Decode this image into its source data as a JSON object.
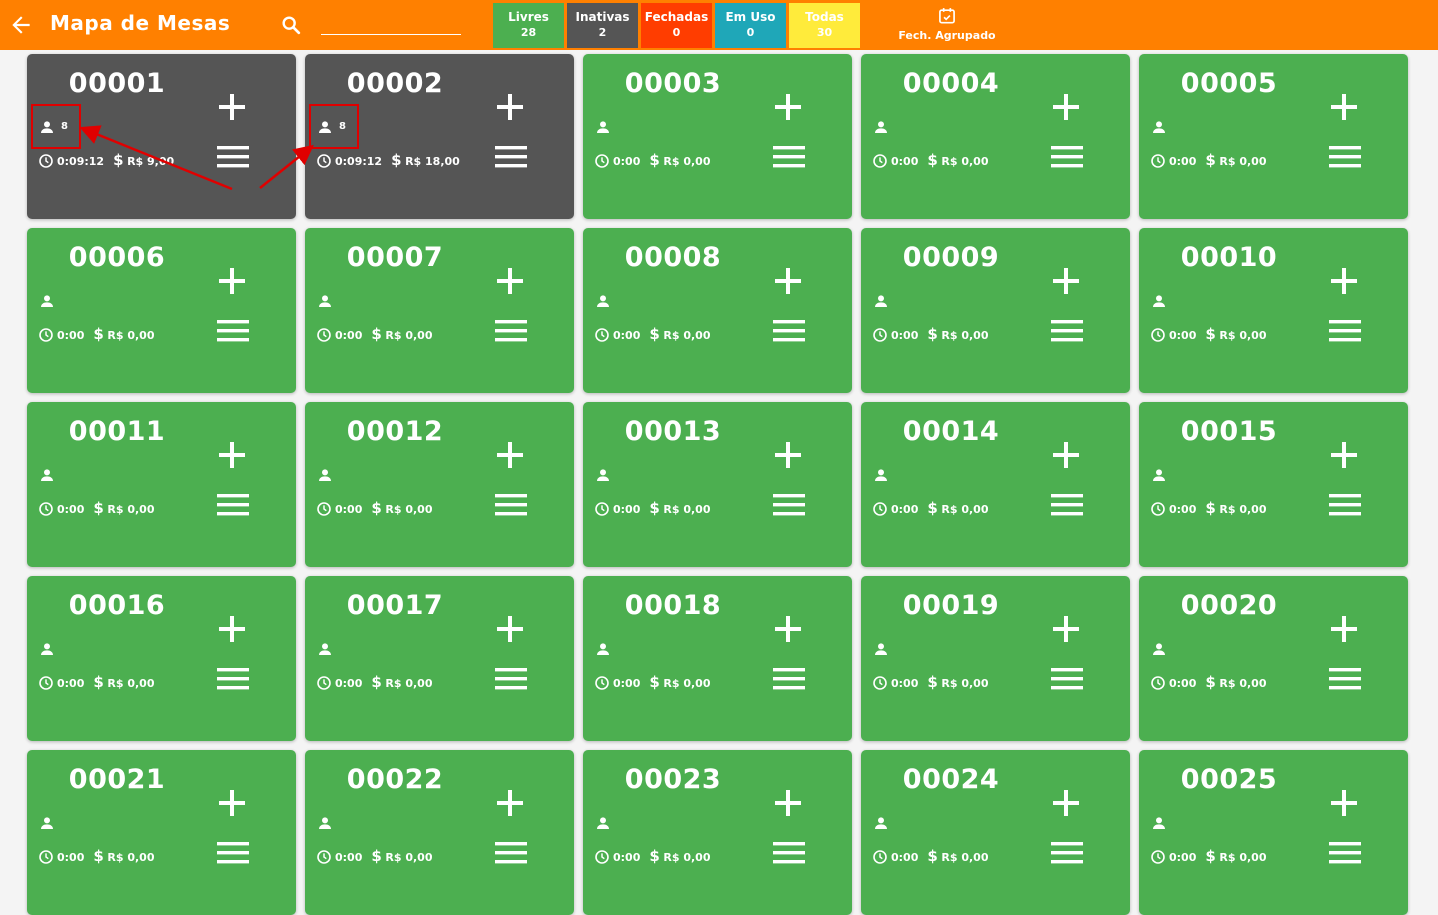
{
  "header": {
    "title": "Mapa de Mesas",
    "search_placeholder": "",
    "filters": [
      {
        "label": "Livres",
        "count": "28",
        "color": "#4caf50"
      },
      {
        "label": "Inativas",
        "count": "2",
        "color": "#555555"
      },
      {
        "label": "Fechadas",
        "count": "0",
        "color": "#ff3d00"
      },
      {
        "label": "Em Uso",
        "count": "0",
        "color": "#1fa7b8"
      },
      {
        "label": "Todas",
        "count": "30",
        "color": "#ffeb3b"
      }
    ],
    "group_close_label": "Fech. Agrupado"
  },
  "colors": {
    "header": "#ff8000",
    "free": "#4caf50",
    "inactive": "#555555",
    "highlight": "#e00000"
  },
  "tables": [
    {
      "number": "00001",
      "status": "inactive",
      "people": "8",
      "time": "0:09:12",
      "amount": "R$ 9,00"
    },
    {
      "number": "00002",
      "status": "inactive",
      "people": "8",
      "time": "0:09:12",
      "amount": "R$ 18,00"
    },
    {
      "number": "00003",
      "status": "free",
      "people": "",
      "time": "0:00",
      "amount": "R$ 0,00"
    },
    {
      "number": "00004",
      "status": "free",
      "people": "",
      "time": "0:00",
      "amount": "R$ 0,00"
    },
    {
      "number": "00005",
      "status": "free",
      "people": "",
      "time": "0:00",
      "amount": "R$ 0,00"
    },
    {
      "number": "00006",
      "status": "free",
      "people": "",
      "time": "0:00",
      "amount": "R$ 0,00"
    },
    {
      "number": "00007",
      "status": "free",
      "people": "",
      "time": "0:00",
      "amount": "R$ 0,00"
    },
    {
      "number": "00008",
      "status": "free",
      "people": "",
      "time": "0:00",
      "amount": "R$ 0,00"
    },
    {
      "number": "00009",
      "status": "free",
      "people": "",
      "time": "0:00",
      "amount": "R$ 0,00"
    },
    {
      "number": "00010",
      "status": "free",
      "people": "",
      "time": "0:00",
      "amount": "R$ 0,00"
    },
    {
      "number": "00011",
      "status": "free",
      "people": "",
      "time": "0:00",
      "amount": "R$ 0,00"
    },
    {
      "number": "00012",
      "status": "free",
      "people": "",
      "time": "0:00",
      "amount": "R$ 0,00"
    },
    {
      "number": "00013",
      "status": "free",
      "people": "",
      "time": "0:00",
      "amount": "R$ 0,00"
    },
    {
      "number": "00014",
      "status": "free",
      "people": "",
      "time": "0:00",
      "amount": "R$ 0,00"
    },
    {
      "number": "00015",
      "status": "free",
      "people": "",
      "time": "0:00",
      "amount": "R$ 0,00"
    },
    {
      "number": "00016",
      "status": "free",
      "people": "",
      "time": "0:00",
      "amount": "R$ 0,00"
    },
    {
      "number": "00017",
      "status": "free",
      "people": "",
      "time": "0:00",
      "amount": "R$ 0,00"
    },
    {
      "number": "00018",
      "status": "free",
      "people": "",
      "time": "0:00",
      "amount": "R$ 0,00"
    },
    {
      "number": "00019",
      "status": "free",
      "people": "",
      "time": "0:00",
      "amount": "R$ 0,00"
    },
    {
      "number": "00020",
      "status": "free",
      "people": "",
      "time": "0:00",
      "amount": "R$ 0,00"
    },
    {
      "number": "00021",
      "status": "free",
      "people": "",
      "time": "0:00",
      "amount": "R$ 0,00"
    },
    {
      "number": "00022",
      "status": "free",
      "people": "",
      "time": "0:00",
      "amount": "R$ 0,00"
    },
    {
      "number": "00023",
      "status": "free",
      "people": "",
      "time": "0:00",
      "amount": "R$ 0,00"
    },
    {
      "number": "00024",
      "status": "free",
      "people": "",
      "time": "0:00",
      "amount": "R$ 0,00"
    },
    {
      "number": "00025",
      "status": "free",
      "people": "",
      "time": "0:00",
      "amount": "R$ 0,00"
    }
  ],
  "icons": {
    "back": "arrow-left-icon",
    "search": "search-icon",
    "group_close": "calendar-check-icon",
    "person": "person-icon",
    "clock": "clock-icon",
    "add": "plus-icon",
    "menu": "menu-icon"
  }
}
